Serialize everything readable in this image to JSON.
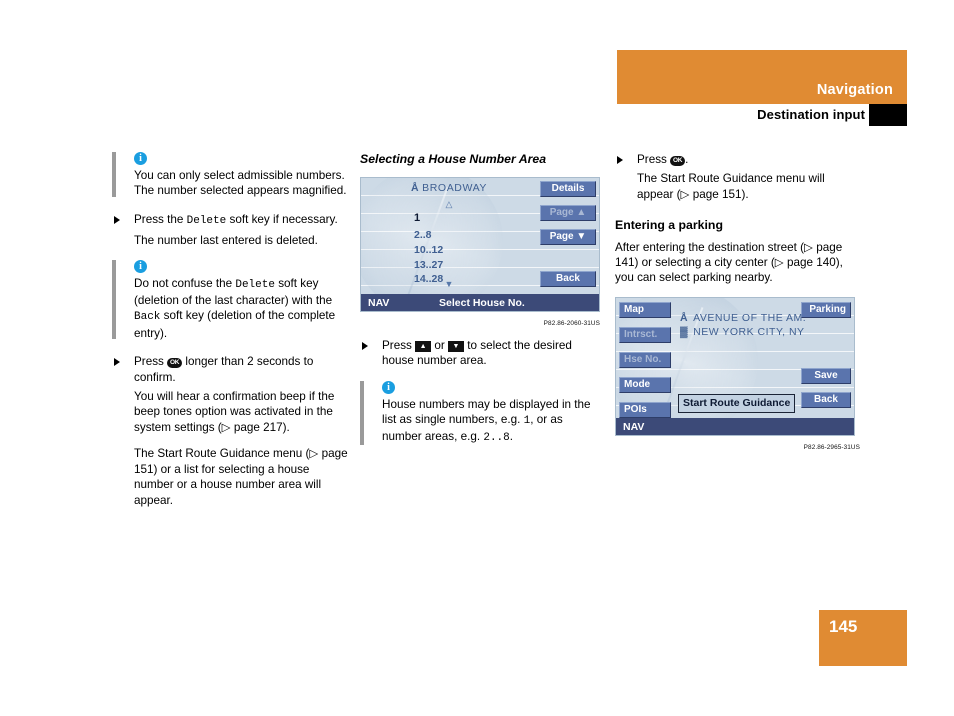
{
  "header": {
    "title": "Navigation",
    "subtitle": "Destination input",
    "band_color": "#e08b33"
  },
  "footer": {
    "page_number": "145"
  },
  "left_column": {
    "note1": {
      "text": "You can only select admissible numbers. The number selected appears magnified."
    },
    "bullet1": {
      "pre": "Press the ",
      "key": "Delete",
      "post": " soft key if necessary."
    },
    "para1": "The number last entered is deleted.",
    "note2": {
      "pre": "Do not confuse the ",
      "key1": "Delete",
      "mid": " soft key (deletion of the last character) with the ",
      "key2": "Back",
      "post": " soft key (deletion of the complete entry)."
    },
    "bullet2": {
      "pre": "Press ",
      "okkey": "OK",
      "post": " longer than 2 seconds to confirm."
    },
    "para2": "You will hear a confirmation beep if the beep tones option was activated in the system settings (▷ page 217).",
    "para3": "The Start Route Guidance menu (▷ page 151) or a list for selecting a house number or a house number area will appear."
  },
  "mid_column": {
    "heading": "Selecting a House Number Area",
    "screen": {
      "street_icon": "Å",
      "street": "BROADWAY",
      "up_arrow": "△",
      "selected_number": "1",
      "number_list": [
        "2..8",
        "10..12",
        "13..27",
        "14..28"
      ],
      "down_arrow": "▼",
      "buttons": {
        "details": "Details",
        "page_up": "Page ▲",
        "page_down": "Page ▼",
        "back": "Back"
      },
      "footer_left": "NAV",
      "footer_title": "Select House No."
    },
    "caption": "P82.86-2060-31US",
    "bullet1": {
      "pre": "Press ",
      "key_up": "▲",
      "mid": " or ",
      "key_down": "▼",
      "post": " to select the desired house number area."
    },
    "note1": {
      "pre": "House numbers may be displayed in the list as single numbers, e.g. ",
      "mono1": "1",
      "mid": ", or as number areas, e.g. ",
      "mono2": "2..8",
      "post": "."
    }
  },
  "right_column": {
    "bullet1": {
      "pre": "Press ",
      "okkey": "OK",
      "post": "."
    },
    "para1": "The Start Route Guidance menu will appear (▷ page 151).",
    "heading": "Entering a parking",
    "para2": "After entering the destination street (▷ page 141) or selecting a city center (▷ page 140), you can select parking nearby.",
    "screen": {
      "left_buttons": [
        {
          "label": "Map",
          "enabled": true
        },
        {
          "label": "Intrsct.",
          "enabled": false
        },
        {
          "label": "Hse No.",
          "enabled": false
        },
        {
          "label": "Mode",
          "enabled": true
        },
        {
          "label": "POIs",
          "enabled": true
        }
      ],
      "right_buttons": [
        {
          "label": "Parking",
          "enabled": true
        },
        {
          "label": "Save",
          "enabled": true
        },
        {
          "label": "Back",
          "enabled": true
        }
      ],
      "dest_line1_icon": "Å",
      "dest_line1": "AVENUE OF THE AM.",
      "dest_line2_icon": "▓",
      "dest_line2": "NEW YORK CITY, NY",
      "start_route_guidance": "Start Route Guidance",
      "footer_left": "NAV"
    },
    "caption": "P82.86-2965-31US"
  }
}
